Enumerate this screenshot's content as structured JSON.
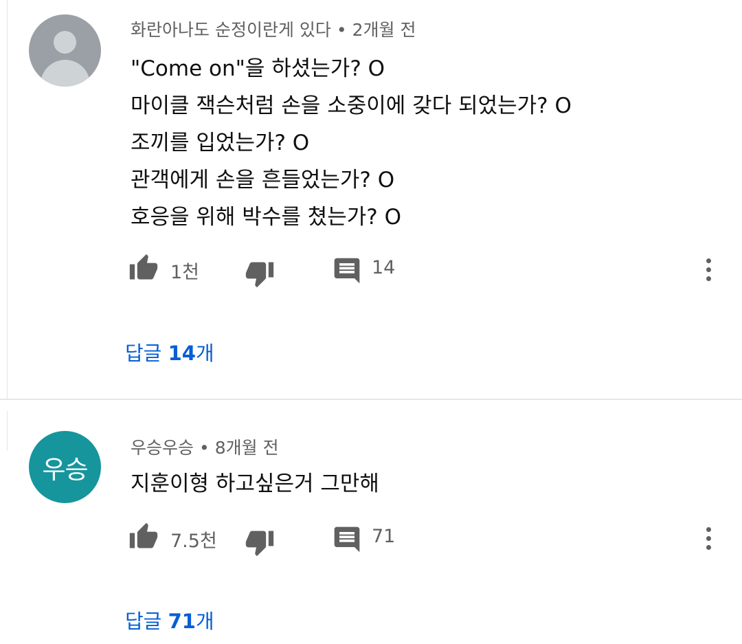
{
  "comments": [
    {
      "author": "화란아나도 순정이란게 있다",
      "separator": "•",
      "time": "2개월 전",
      "avatar_type": "default-person-icon",
      "lines": [
        "\"Come on\"을 하셨는가? O",
        "마이클 잭슨처럼 손을 소중이에 갖다 되었는가?  O",
        "조끼를 입었는가? O",
        "관객에게 손을 흔들었는가? O",
        "호응을 위해 박수를 쳤는가? O"
      ],
      "likes": "1천",
      "reply_count": "14",
      "replies_prefix": "답글 ",
      "replies_num": "14",
      "replies_suffix": "개"
    },
    {
      "author": "우승우승",
      "separator": "•",
      "time": "8개월 전",
      "avatar_type": "initials",
      "avatar_text": "우승",
      "avatar_color": "#16959d",
      "lines": [
        "지훈이형 하고싶은거 그만해"
      ],
      "likes": "7.5천",
      "reply_count": "71",
      "replies_prefix": "답글 ",
      "replies_num": "71",
      "replies_suffix": "개"
    }
  ],
  "colors": {
    "link": "#065fd4",
    "meta": "#606060",
    "text": "#0f0f0f",
    "divider": "#e6e6e6"
  },
  "icons": {
    "like": "thumb-up-icon",
    "dislike": "thumb-down-icon",
    "reply": "comment-icon",
    "more": "more-vert-icon"
  }
}
